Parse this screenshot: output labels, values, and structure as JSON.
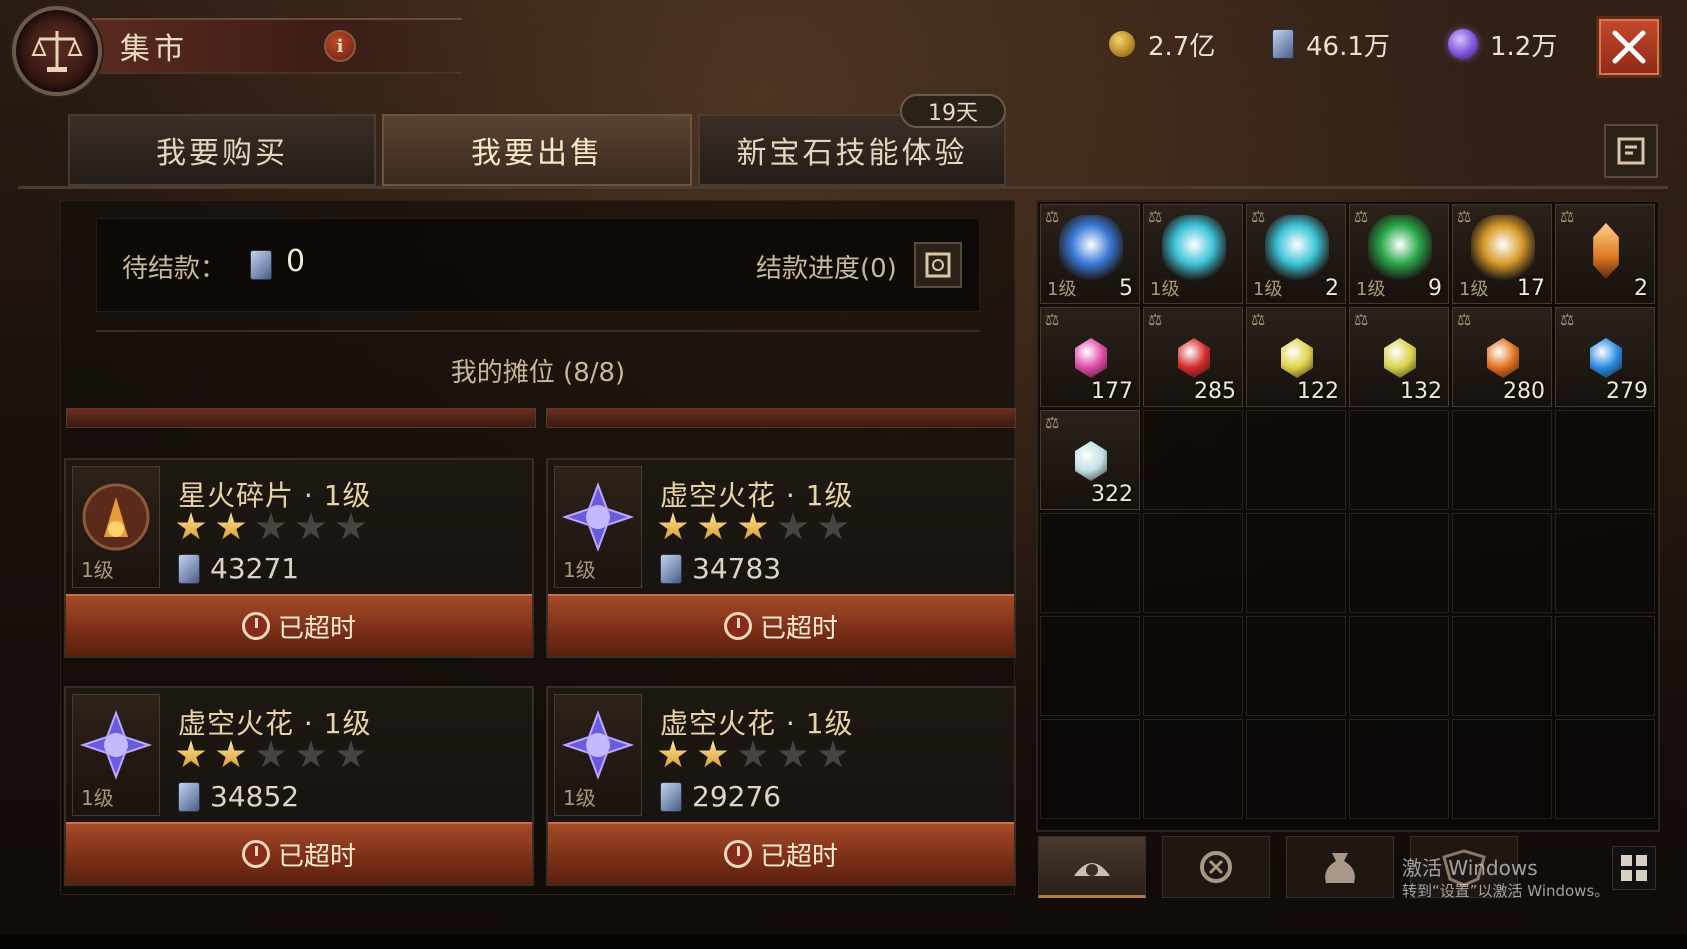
{
  "header": {
    "title": "集市",
    "info_icon": "info-icon",
    "currencies": [
      {
        "icon": "gold-coin-icon",
        "value": "2.7亿"
      },
      {
        "icon": "ticket-icon",
        "value": "46.1万"
      },
      {
        "icon": "eternal-orb-icon",
        "value": "1.2万"
      }
    ]
  },
  "tabs": [
    {
      "label": "我要购买",
      "active": false
    },
    {
      "label": "我要出售",
      "active": true
    },
    {
      "label": "新宝石技能体验",
      "active": false
    }
  ],
  "days_badge": "19天",
  "pending": {
    "label": "待结款：",
    "value": "0",
    "progress_label": "结款进度(0)"
  },
  "stall": {
    "title": "我的摊位 (8/8)",
    "listings": [
      {
        "name": "星火碎片 · 1级",
        "level": "1级",
        "stars": 2,
        "price": "43271",
        "status": "已超时"
      },
      {
        "name": "虚空火花 · 1级",
        "level": "1级",
        "stars": 3,
        "price": "34783",
        "status": "已超时"
      },
      {
        "name": "虚空火花 · 1级",
        "level": "1级",
        "stars": 2,
        "price": "34852",
        "status": "已超时"
      },
      {
        "name": "虚空火花 · 1级",
        "level": "1级",
        "stars": 2,
        "price": "29276",
        "status": "已超时"
      }
    ]
  },
  "inventory": {
    "items": [
      {
        "kind": "crystal",
        "color": "#3a7ad8",
        "level": "1级",
        "count": "5"
      },
      {
        "kind": "crystal",
        "color": "#3ec4d8",
        "level": "1级",
        "count": ""
      },
      {
        "kind": "crystal",
        "color": "#3ec4d8",
        "level": "1级",
        "count": "2"
      },
      {
        "kind": "crystal",
        "color": "#2aa84a",
        "level": "1级",
        "count": "9"
      },
      {
        "kind": "crystal",
        "color": "#d89a2a",
        "level": "1级",
        "count": "17"
      },
      {
        "kind": "shard",
        "color": "#e07a20",
        "level": "",
        "count": "2"
      },
      {
        "kind": "gem",
        "color": "#e04aa8",
        "level": "",
        "count": "177"
      },
      {
        "kind": "gem",
        "color": "#d42a2a",
        "level": "",
        "count": "285"
      },
      {
        "kind": "gem",
        "color": "#e0d24a",
        "level": "",
        "count": "122"
      },
      {
        "kind": "gem",
        "color": "#d8d24a",
        "level": "",
        "count": "132"
      },
      {
        "kind": "gem",
        "color": "#e0701e",
        "level": "",
        "count": "280"
      },
      {
        "kind": "gem",
        "color": "#2a8ae0",
        "level": "",
        "count": "279"
      },
      {
        "kind": "gem",
        "color": "#bfe0e4",
        "level": "",
        "count": "322"
      }
    ],
    "bottom_tabs": [
      "gem-bag-icon",
      "rune-icon",
      "pouch-icon",
      "crest-icon"
    ]
  },
  "watermark": {
    "line1": "激活 Windows",
    "line2": "转到“设置”以激活 Windows。"
  }
}
